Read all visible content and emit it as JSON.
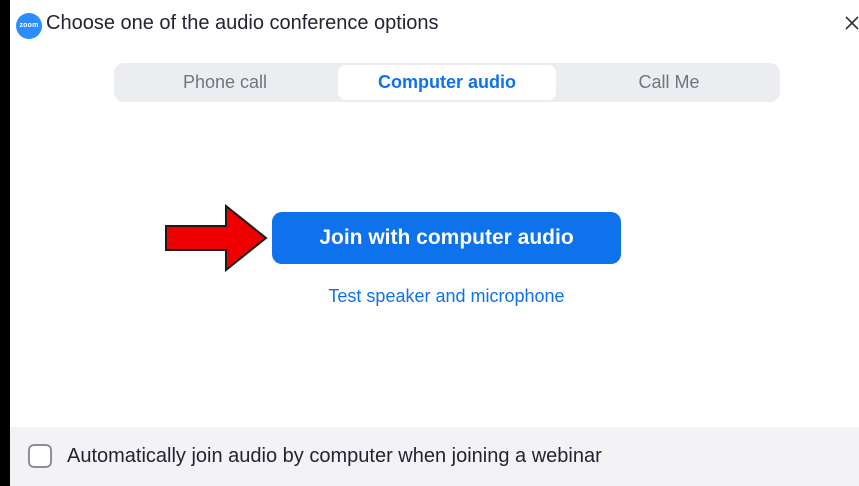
{
  "app": {
    "logo_text": "zoom",
    "title": "Choose one of the audio conference options",
    "close_icon": "close-icon",
    "brand_color": "#0e72ed"
  },
  "tabs": [
    {
      "label": "Phone call",
      "active": false
    },
    {
      "label": "Computer audio",
      "active": true
    },
    {
      "label": "Call Me",
      "active": false
    }
  ],
  "main": {
    "join_label": "Join with computer audio",
    "test_label": "Test speaker and microphone",
    "annotation_icon": "red-arrow-icon",
    "annotation_color": "#ee0000"
  },
  "footer": {
    "checkbox_checked": false,
    "checkbox_label": "Automatically join audio by computer when joining a webinar"
  }
}
